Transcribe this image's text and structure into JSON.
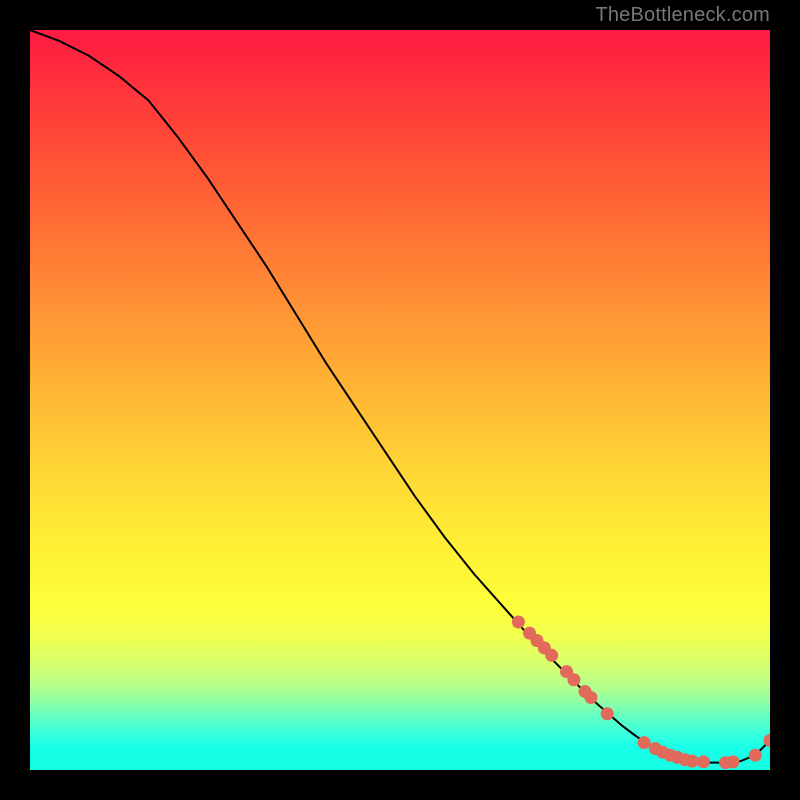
{
  "watermark": "TheBottleneck.com",
  "chart_data": {
    "type": "line",
    "title": "",
    "xlabel": "",
    "ylabel": "",
    "xlim": [
      0,
      100
    ],
    "ylim": [
      0,
      100
    ],
    "series": [
      {
        "name": "curve",
        "x": [
          0,
          4,
          8,
          12,
          16,
          20,
          24,
          28,
          32,
          36,
          40,
          44,
          48,
          52,
          56,
          60,
          64,
          68,
          72,
          76,
          80,
          82,
          84,
          86,
          88,
          90,
          92,
          94,
          96,
          98,
          100
        ],
        "y": [
          100,
          98.5,
          96.5,
          93.8,
          90.5,
          85.5,
          80,
          74,
          68,
          61.5,
          55,
          49,
          43,
          37,
          31.5,
          26.5,
          22,
          17.5,
          13.5,
          9.5,
          6,
          4.5,
          3.2,
          2.2,
          1.5,
          1.2,
          1,
          1,
          1.2,
          2,
          4
        ]
      }
    ],
    "markers": [
      {
        "x": 66,
        "y": 20
      },
      {
        "x": 67.5,
        "y": 18.5
      },
      {
        "x": 68.5,
        "y": 17.5
      },
      {
        "x": 69.5,
        "y": 16.5
      },
      {
        "x": 70.5,
        "y": 15.5
      },
      {
        "x": 72.5,
        "y": 13.3
      },
      {
        "x": 73.5,
        "y": 12.2
      },
      {
        "x": 75,
        "y": 10.6
      },
      {
        "x": 75.8,
        "y": 9.8
      },
      {
        "x": 78,
        "y": 7.6
      },
      {
        "x": 83,
        "y": 3.7
      },
      {
        "x": 84.5,
        "y": 2.9
      },
      {
        "x": 85.5,
        "y": 2.4
      },
      {
        "x": 86.5,
        "y": 2
      },
      {
        "x": 87.5,
        "y": 1.7
      },
      {
        "x": 88.5,
        "y": 1.4
      },
      {
        "x": 89.5,
        "y": 1.2
      },
      {
        "x": 91,
        "y": 1.1
      },
      {
        "x": 94,
        "y": 1
      },
      {
        "x": 95,
        "y": 1.1
      },
      {
        "x": 98,
        "y": 2
      },
      {
        "x": 100,
        "y": 4
      }
    ],
    "marker_color": "#e26a5a"
  }
}
